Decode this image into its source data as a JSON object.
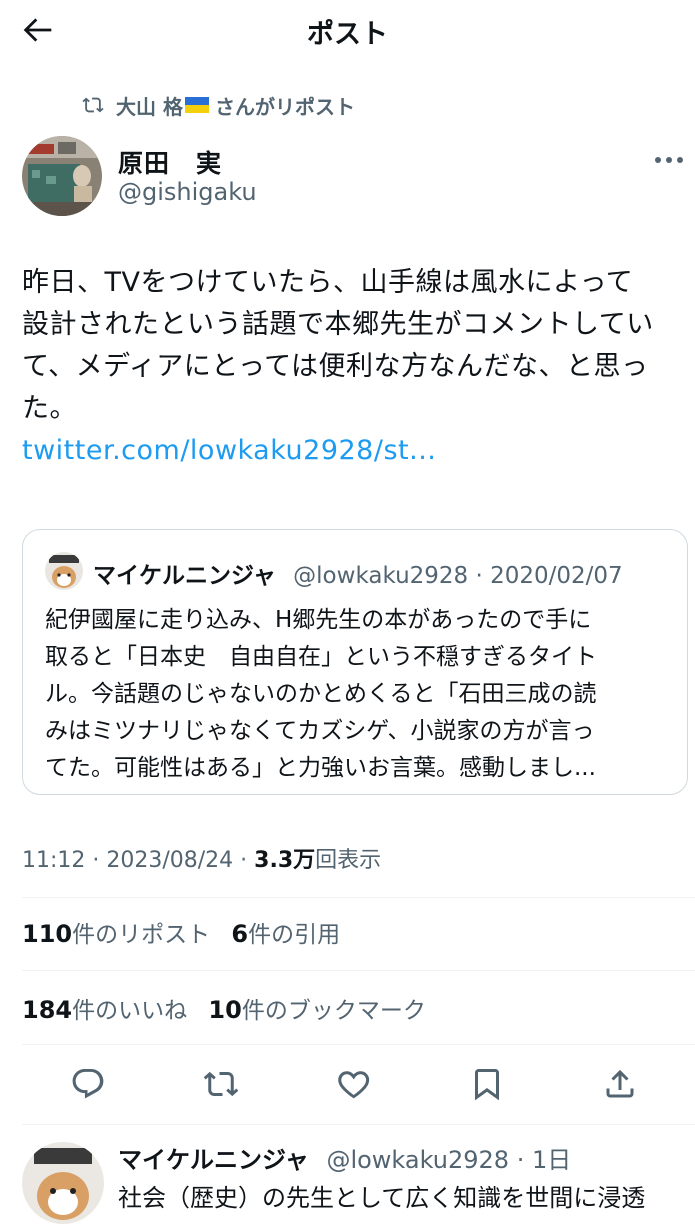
{
  "header": {
    "title": "ポスト",
    "back_icon": "arrow-left-icon"
  },
  "repost": {
    "user": "大山 格",
    "suffix": "さんがリポスト",
    "icon": "repost-icon"
  },
  "author": {
    "name": "原田　実",
    "handle": "@gishigaku"
  },
  "tweet": {
    "lines": [
      "昨日、TVをつけていたら、山手線は風水によって",
      "設計されたという話題で本郷先生がコメントしてい",
      "て、メディアにとっては便利な方なんだな、と思っ",
      "た。"
    ],
    "link": "twitter.com/lowkaku2928/st..."
  },
  "quote": {
    "name": "マイケルニンジャ",
    "handle": "@lowkaku2928",
    "date": "· 2020/02/07",
    "lines": [
      "紀伊國屋に走り込み、H郷先生の本があったので手に",
      "取ると「日本史　自由自在」という不穏すぎるタイト",
      "ル。今話題のじゃないのかとめくると「石田三成の読",
      "みはミツナリじゃなくてカズシゲ、小説家の方が言っ",
      "てた。可能性はある」と力強いお言葉。感動しまし..."
    ]
  },
  "meta": {
    "time": "11:12 · 2023/08/24 · ",
    "views": "3.3万",
    "views_label": "回表示"
  },
  "stats": {
    "reposts": "110",
    "reposts_label": "件のリポスト",
    "quotes": "6",
    "quotes_label": "件の引用",
    "likes": "184",
    "likes_label": "件のいいね",
    "bookmarks": "10",
    "bookmarks_label": "件のブックマーク"
  },
  "actions": [
    "reply-icon",
    "repost-icon",
    "like-icon",
    "bookmark-icon",
    "share-icon"
  ],
  "reply": {
    "name": "マイケルニンジャ",
    "handle": "@lowkaku2928",
    "time": "· 1日",
    "text": "社会（歴史）の先生として広く知識を世間に浸透"
  },
  "colors": {
    "link": "#1d9bf0",
    "secondary_text": "#536471",
    "border": "#cfd9de",
    "flag_blue": "#2a6fd6",
    "flag_yellow": "#f5cf0b"
  }
}
